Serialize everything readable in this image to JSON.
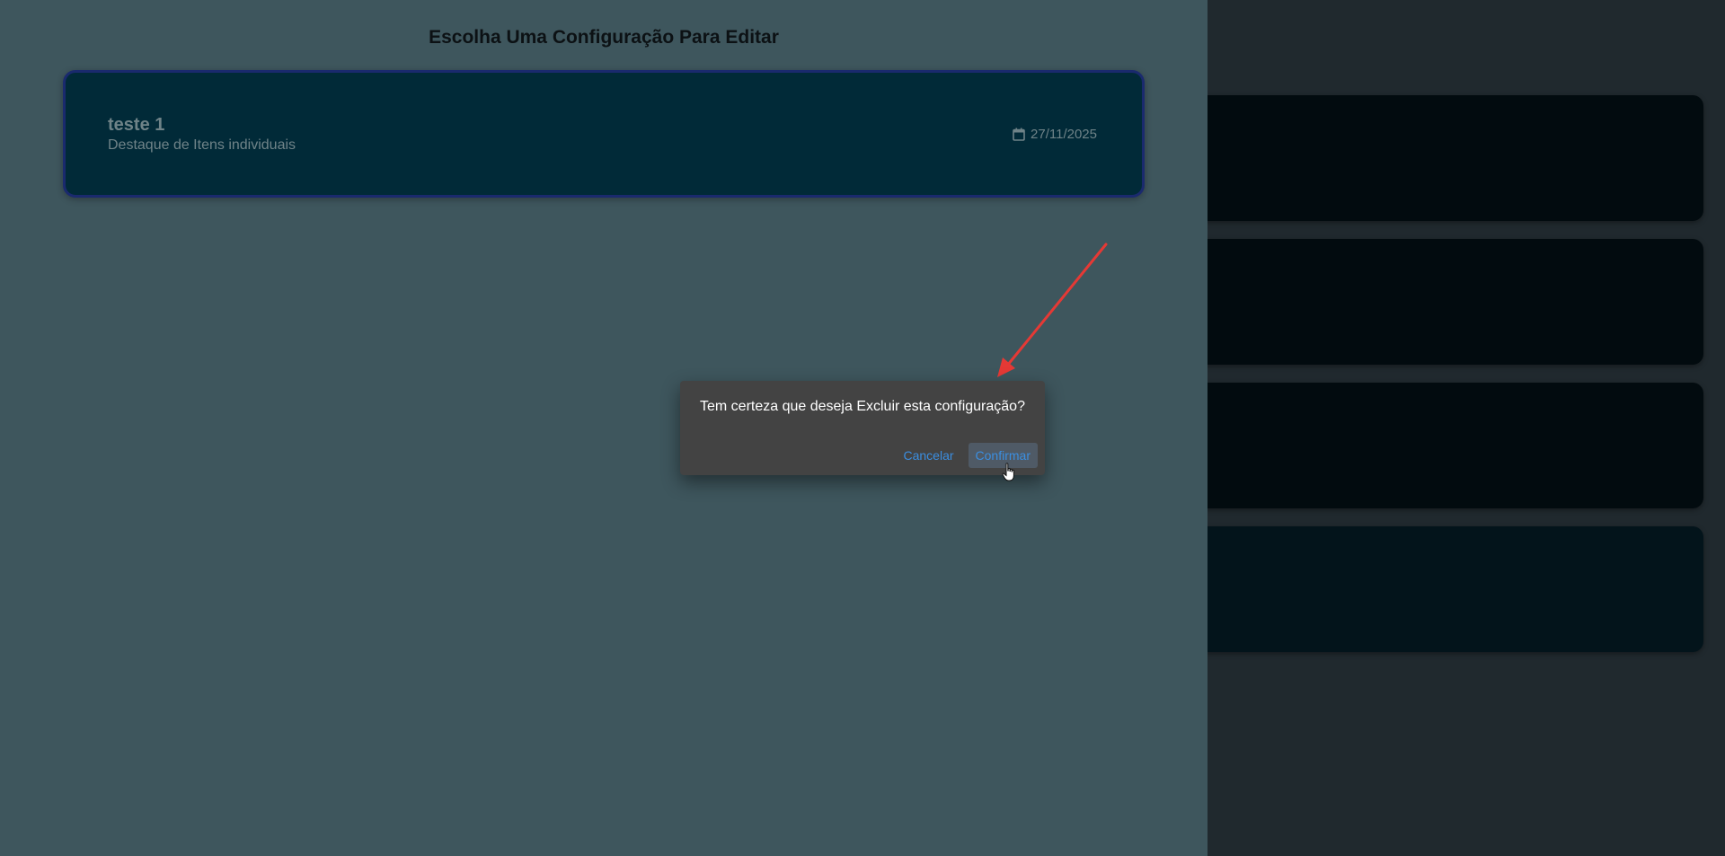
{
  "drawer": {
    "title": "Escolha Uma Configuração Para Editar",
    "configs": [
      {
        "name": "teste 1",
        "type": "Destaque de Itens individuais",
        "date": "27/11/2025",
        "icon": "calendar-icon"
      }
    ]
  },
  "dialog": {
    "message": "Tem certeza que deseja Excluir esta configuração?",
    "cancel_label": "Cancelar",
    "confirm_label": "Confirmar"
  },
  "colors": {
    "drawer_bg": "#3e565d",
    "card_bg": "#012a38",
    "card_border": "#1a2a6e",
    "dialog_bg": "#434343",
    "action_text": "#3b8ee0",
    "annotation_arrow": "#e53935"
  }
}
